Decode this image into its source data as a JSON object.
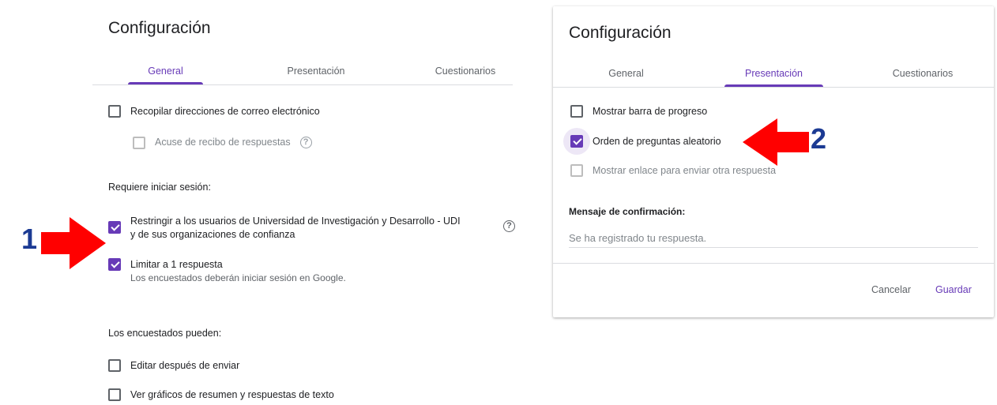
{
  "left_panel": {
    "title": "Configuración",
    "tabs": [
      {
        "label": "General",
        "active": true
      },
      {
        "label": "Presentación",
        "active": false
      },
      {
        "label": "Cuestionarios",
        "active": false
      }
    ],
    "collect_emails": {
      "label": "Recopilar direcciones de correo electrónico",
      "checked": false
    },
    "response_receipt": {
      "label": "Acuse de recibo de respuestas",
      "checked": false,
      "disabled": true
    },
    "login_heading": "Requiere iniciar sesión:",
    "restrict_users": {
      "label_line1": "Restringir a los usuarios de Universidad de Investigación y Desarrollo - UDI",
      "label_line2": "y de sus organizaciones de confianza",
      "checked": true
    },
    "limit_one": {
      "label": "Limitar a 1 respuesta",
      "sub": "Los encuestados deberán iniciar sesión en Google.",
      "checked": true
    },
    "respondents_heading": "Los encuestados pueden:",
    "edit_after": {
      "label": "Editar después de enviar",
      "checked": false
    },
    "view_charts": {
      "label": "Ver gráficos de resumen y respuestas de texto",
      "checked": false
    }
  },
  "right_panel": {
    "title": "Configuración",
    "tabs": [
      {
        "label": "General",
        "active": false
      },
      {
        "label": "Presentación",
        "active": true
      },
      {
        "label": "Cuestionarios",
        "active": false
      }
    ],
    "progress_bar": {
      "label": "Mostrar barra de progreso",
      "checked": false
    },
    "shuffle_order": {
      "label": "Orden de preguntas aleatorio",
      "checked": true
    },
    "show_link": {
      "label": "Mostrar enlace para enviar otra respuesta",
      "checked": false,
      "disabled": true
    },
    "confirmation": {
      "label": "Mensaje de confirmación:",
      "value": "Se ha registrado tu respuesta."
    },
    "cancel_label": "Cancelar",
    "save_label": "Guardar"
  },
  "annotations": {
    "arrow1_number": "1",
    "arrow2_number": "2",
    "arrow_color": "#ff0000"
  },
  "colors": {
    "accent": "#673ab7",
    "number_blue": "#1b3a93"
  }
}
